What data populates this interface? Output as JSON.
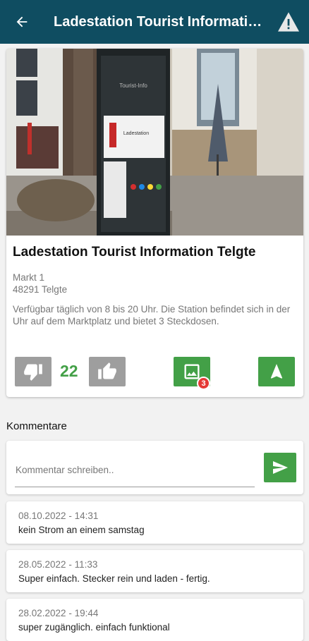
{
  "appbar": {
    "title": "Ladestation Tourist Information Telgte"
  },
  "station": {
    "title": "Ladestation Tourist Information Telgte",
    "street": "Markt 1",
    "city": "48291 Telgte",
    "description": "Verfügbar täglich von 8 bis 20 Uhr. Die Station befindet sich in der Uhr auf dem Marktplatz und bietet 3 Steckdosen.",
    "vote_count": "22",
    "photo_count": "3"
  },
  "photo": {
    "sign_text": "Tourist-Info",
    "sign_panel_text": "Ladestation"
  },
  "comments": {
    "heading": "Kommentare",
    "placeholder": "Kommentar schreiben..",
    "items": [
      {
        "date": "08.10.2022 - 14:31",
        "text": "kein Strom an einem samstag"
      },
      {
        "date": "28.05.2022 - 11:33",
        "text": "Super einfach. Stecker rein und laden - fertig."
      },
      {
        "date": "28.02.2022 - 19:44",
        "text": "super zugänglich. einfach funktional"
      }
    ]
  },
  "colors": {
    "appbar": "#0f4d61",
    "accent_green": "#43a047",
    "vote_grey": "#9e9e9e",
    "badge_red": "#e53935"
  },
  "icons": [
    "back-arrow-icon",
    "warning-icon",
    "thumb-down-icon",
    "thumb-up-icon",
    "image-icon",
    "navigation-arrow-icon",
    "send-icon"
  ]
}
